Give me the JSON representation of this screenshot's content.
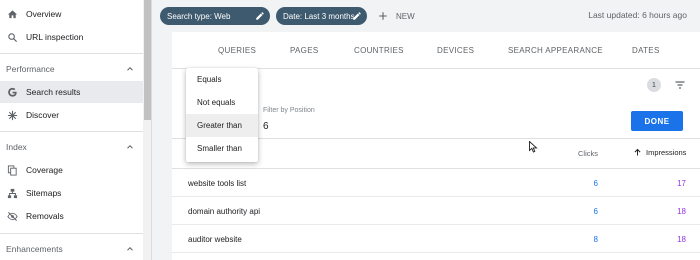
{
  "sidebar": {
    "items_top": [
      {
        "label": "Overview",
        "icon": "home-icon"
      },
      {
        "label": "URL inspection",
        "icon": "search-icon"
      }
    ],
    "sections": [
      {
        "label": "Performance"
      },
      {
        "label": "Index"
      },
      {
        "label": "Enhancements"
      }
    ],
    "performance_items": [
      {
        "label": "Search results",
        "icon": "google-g-icon",
        "active": true
      },
      {
        "label": "Discover",
        "icon": "asterisk-icon"
      }
    ],
    "index_items": [
      {
        "label": "Coverage",
        "icon": "copy-pages-icon"
      },
      {
        "label": "Sitemaps",
        "icon": "sitemap-icon"
      },
      {
        "label": "Removals",
        "icon": "eye-off-icon"
      }
    ]
  },
  "topbar": {
    "chips": [
      {
        "label": "Search type: Web"
      },
      {
        "label": "Date: Last 3 months"
      }
    ],
    "new_label": "NEW",
    "updated": "Last updated: 6 hours ago"
  },
  "tabs": [
    "QUERIES",
    "PAGES",
    "COUNTRIES",
    "DEVICES",
    "SEARCH APPEARANCE",
    "DATES"
  ],
  "active_tab": "QUERIES",
  "filter": {
    "count": "1",
    "position_label": "Filter by Position",
    "position_value": "6",
    "done_label": "DONE"
  },
  "dropdown": {
    "options": [
      "Equals",
      "Not equals",
      "Greater than",
      "Smaller than"
    ],
    "highlighted": "Greater than"
  },
  "table": {
    "headers": {
      "clicks": "Clicks",
      "impressions": "Impressions"
    },
    "rows": [
      {
        "query": "website tools list",
        "clicks": "6",
        "impressions": "17"
      },
      {
        "query": "domain authority api",
        "clicks": "6",
        "impressions": "18"
      },
      {
        "query": "auditor website",
        "clicks": "8",
        "impressions": "18"
      }
    ]
  },
  "colors": {
    "accent": "#1a73e8",
    "chip": "#3e5a6f",
    "clicks": "#1a73e8",
    "impressions": "#9334e6"
  }
}
